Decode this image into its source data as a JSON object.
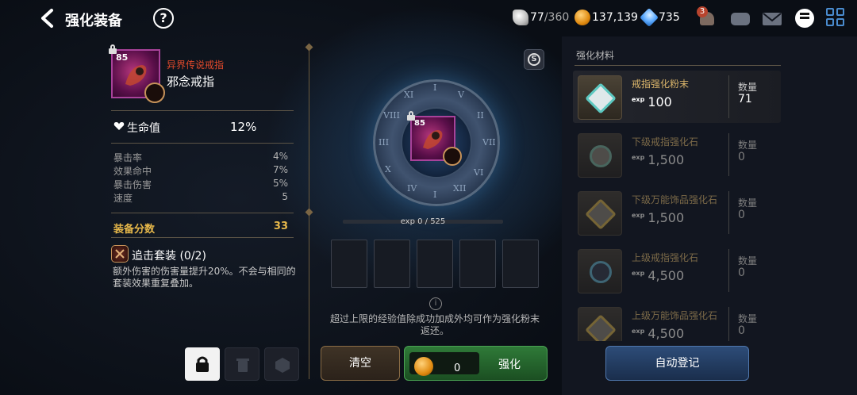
{
  "header": {
    "title": "强化装备",
    "help_icon": "question-circle-icon",
    "resources": {
      "stamina_current": "77",
      "stamina_max": "/360",
      "gold": "137,139",
      "gems": "735"
    },
    "bell_badge": "3"
  },
  "item": {
    "level": "85",
    "rarity": "异界传说戒指",
    "name": "邪念戒指",
    "main_stat": {
      "label": "生命值",
      "value": "12%"
    },
    "sub_stats": [
      {
        "label": "暴击率",
        "value": "4%"
      },
      {
        "label": "效果命中",
        "value": "7%"
      },
      {
        "label": "暴击伤害",
        "value": "5%"
      },
      {
        "label": "速度",
        "value": "5"
      }
    ],
    "score": {
      "label": "装备分数",
      "value": "33"
    },
    "set": {
      "title": "追击套装 (0/2)",
      "description": "额外伤害的伤害量提升20%。不会与相同的套装效果重复叠加。"
    }
  },
  "enhance": {
    "ring_numerals": [
      "I",
      "II",
      "III",
      "IV",
      "V",
      "VI",
      "VII",
      "VIII",
      "IX",
      "X",
      "XI",
      "XII"
    ],
    "exp_text": "exp 0 / 525",
    "exp_progress": 0,
    "slots": 5,
    "note": "超过上限的经验值除成功加成外均可作为强化粉末返还。",
    "clear_label": "清空",
    "cost": "0",
    "enhance_label": "强化"
  },
  "materials": {
    "title": "强化材料",
    "qty_label": "数量",
    "items": [
      {
        "name": "戒指强化粉末",
        "exp": "100",
        "qty": "71",
        "color": "#5cc8c0",
        "active": true
      },
      {
        "name": "下级戒指强化石",
        "exp": "1,500",
        "qty": "0",
        "color": "#7fb39a",
        "active": false
      },
      {
        "name": "下级万能饰品强化石",
        "exp": "1,500",
        "qty": "0",
        "color": "#d8b24a",
        "active": false
      },
      {
        "name": "上级戒指强化石",
        "exp": "4,500",
        "qty": "0",
        "color": "#6ab4c8",
        "active": false
      },
      {
        "name": "上级万能饰品强化石",
        "exp": "4,500",
        "qty": "0",
        "color": "#d8b24a",
        "active": false
      }
    ],
    "auto_label": "自动登记"
  },
  "colors": {
    "rarity_red": "#e0492b",
    "score_gold": "#e7b84a",
    "enhance_green": "#2f7a38",
    "auto_blue": "#2d4c78"
  }
}
